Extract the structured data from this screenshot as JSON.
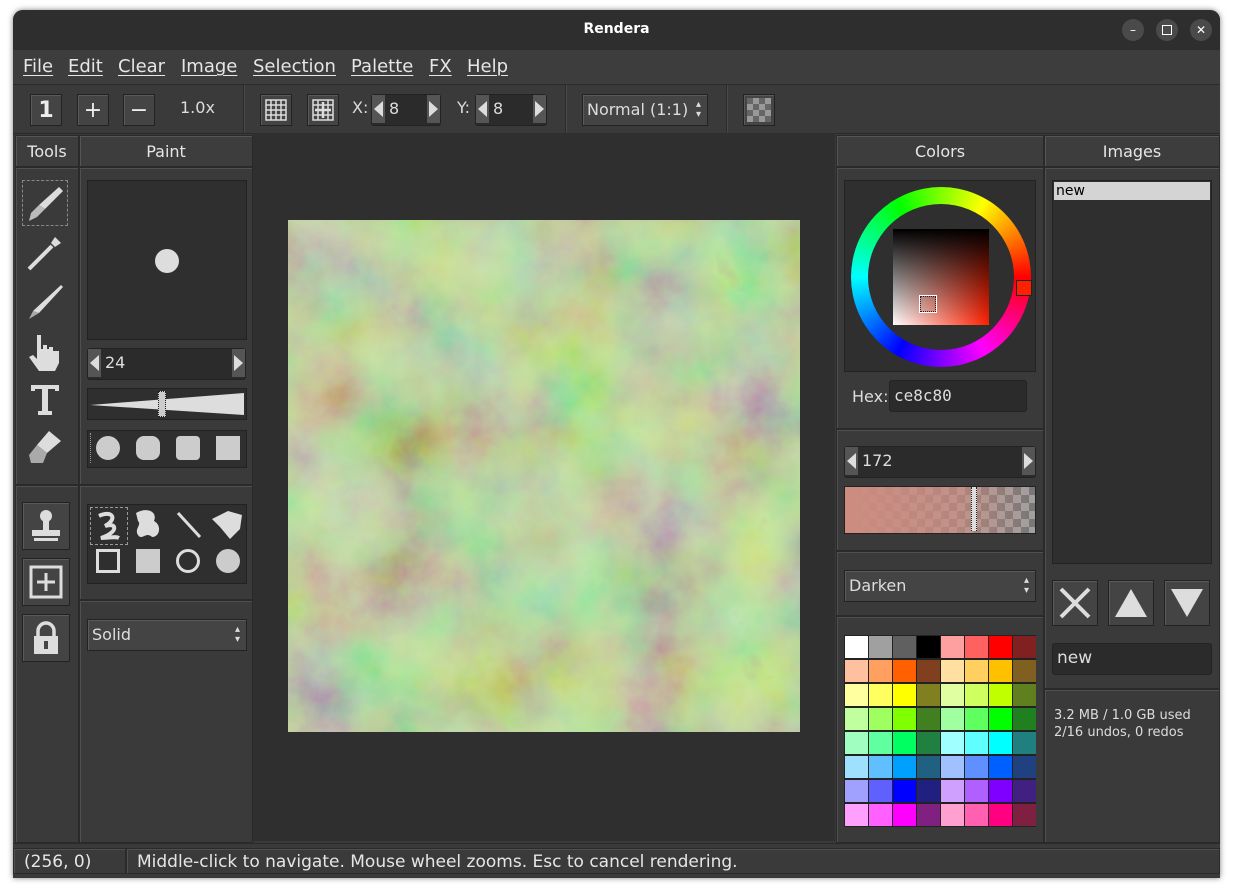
{
  "window": {
    "title": "Rendera"
  },
  "menu": [
    "File",
    "Edit",
    "Clear",
    "Image",
    "Selection",
    "Palette",
    "FX",
    "Help"
  ],
  "toolbar": {
    "zoom_one": "1",
    "zoom_in": "+",
    "zoom_out": "−",
    "zoom_level": "1.0x",
    "x_label": "X:",
    "x_value": "8",
    "y_label": "Y:",
    "y_value": "8",
    "aspect": "Normal (1:1)"
  },
  "tabs": {
    "tools": "Tools",
    "paint": "Paint",
    "colors": "Colors",
    "images": "Images"
  },
  "tools": [
    "paintbrush-icon",
    "eyedropper-icon",
    "knife-icon",
    "hand-icon",
    "text-icon",
    "smudge-icon"
  ],
  "tools_bottom": [
    "stamp-icon",
    "add-layer-icon",
    "lock-icon"
  ],
  "paint": {
    "brush_size": "24",
    "shapes": [
      "circle",
      "rounded-circle",
      "rounded-square",
      "square"
    ],
    "strokes": [
      "freehand-icon",
      "fill-blob-icon",
      "line-icon",
      "polygon-icon",
      "rect-outline-icon",
      "rect-fill-icon",
      "oval-outline-icon",
      "oval-fill-icon"
    ],
    "mode": "Solid"
  },
  "colors": {
    "hex_label": "Hex:",
    "hex_value": "ce8c80",
    "alpha_value": "172",
    "blend_mode": "Darken",
    "current_color": "#ce8c80",
    "palette": [
      [
        "#ffffff",
        "#a0a0a0",
        "#606060",
        "#000000",
        "#ffa0a0",
        "#ff6060",
        "#ff0000",
        "#802020"
      ],
      [
        "#ffc0a0",
        "#ffa060",
        "#ff6000",
        "#804020",
        "#ffe0a0",
        "#ffd060",
        "#ffc000",
        "#806020"
      ],
      [
        "#ffffa0",
        "#ffff60",
        "#ffff00",
        "#808020",
        "#e0ffa0",
        "#d0ff60",
        "#c0ff00",
        "#608020"
      ],
      [
        "#c0ffa0",
        "#a0ff60",
        "#80ff00",
        "#408020",
        "#a0ffa0",
        "#60ff60",
        "#00ff00",
        "#208020"
      ],
      [
        "#a0ffc0",
        "#60ffa0",
        "#00ff60",
        "#208040",
        "#a0ffff",
        "#60ffff",
        "#00ffff",
        "#208080"
      ],
      [
        "#a0e0ff",
        "#60c0ff",
        "#00a0ff",
        "#206080",
        "#a0c0ff",
        "#6090ff",
        "#0060ff",
        "#204080"
      ],
      [
        "#a0a0ff",
        "#6060ff",
        "#0000ff",
        "#202080",
        "#d0a0ff",
        "#b060ff",
        "#8000ff",
        "#402080"
      ],
      [
        "#ffa0ff",
        "#ff60ff",
        "#ff00ff",
        "#802080",
        "#ffa0d0",
        "#ff60b0",
        "#ff0080",
        "#802040"
      ]
    ]
  },
  "images": {
    "list": [
      "new"
    ],
    "name_field": "new",
    "memory": "3.2 MB / 1.0 GB used",
    "undos": "2/16 undos, 0 redos"
  },
  "status": {
    "coords": "(256, 0)",
    "message": "Middle-click to navigate. Mouse wheel zooms. Esc to cancel rendering."
  }
}
